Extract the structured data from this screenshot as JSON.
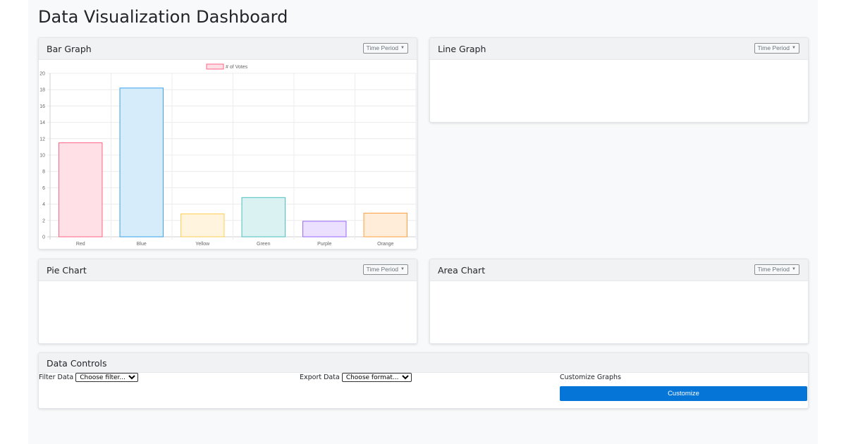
{
  "page": {
    "title": "Data Visualization Dashboard"
  },
  "cards": {
    "bar": {
      "title": "Bar Graph",
      "dropdown": "Time Period"
    },
    "line": {
      "title": "Line Graph",
      "dropdown": "Time Period"
    },
    "pie": {
      "title": "Pie Chart",
      "dropdown": "Time Period"
    },
    "area": {
      "title": "Area Chart",
      "dropdown": "Time Period"
    }
  },
  "controls": {
    "title": "Data Controls",
    "filter_label": "Filter Data",
    "filter_value": "Choose filter...",
    "export_label": "Export Data",
    "export_value": "Choose format...",
    "customize_label": "Customize Graphs",
    "customize_button": "Customize"
  },
  "chart_data": {
    "type": "bar",
    "categories": [
      "Red",
      "Blue",
      "Yellow",
      "Green",
      "Purple",
      "Orange"
    ],
    "series": [
      {
        "name": "# of Votes",
        "values": [
          11.5,
          18.2,
          2.8,
          4.8,
          1.9,
          2.9
        ]
      }
    ],
    "fill_colors": [
      "#ffe0e6",
      "#d7ecfb",
      "#fff4dd",
      "#dbf2f2",
      "#ebe0ff",
      "#ffecd9"
    ],
    "stroke_colors": [
      "#ff6384",
      "#36a2eb",
      "#ffce56",
      "#4bc0c0",
      "#9966ff",
      "#ff9f40"
    ],
    "yticks": [
      0,
      2,
      4,
      6,
      8,
      10,
      12,
      14,
      16,
      18,
      20
    ],
    "ylim": [
      0,
      20
    ],
    "grid": true,
    "legend": "top"
  }
}
